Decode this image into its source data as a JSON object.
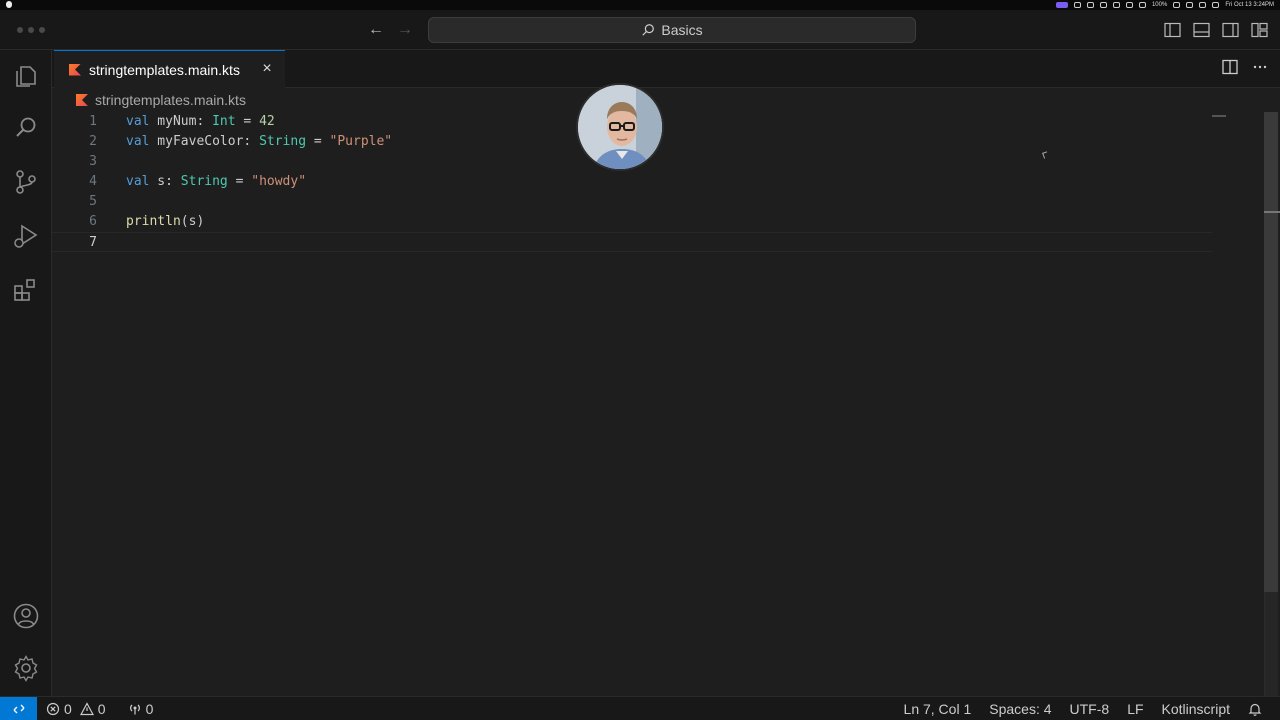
{
  "titlebar": {
    "search_label": "Basics"
  },
  "tab": {
    "label": "stringtemplates.main.kts",
    "close_glyph": "×"
  },
  "breadcrumb": {
    "file": "stringtemplates.main.kts"
  },
  "editor": {
    "line_numbers": [
      "1",
      "2",
      "3",
      "4",
      "5",
      "6",
      "7"
    ],
    "current_line": 7,
    "lines": [
      [
        {
          "t": "val",
          "c": "kw"
        },
        {
          "t": " myNum: ",
          "c": ""
        },
        {
          "t": "Int",
          "c": "ty"
        },
        {
          "t": " = ",
          "c": ""
        },
        {
          "t": "42",
          "c": "num"
        }
      ],
      [
        {
          "t": "val",
          "c": "kw"
        },
        {
          "t": " myFaveColor: ",
          "c": ""
        },
        {
          "t": "String",
          "c": "ty"
        },
        {
          "t": " = ",
          "c": ""
        },
        {
          "t": "\"Purple\"",
          "c": "str"
        }
      ],
      [],
      [
        {
          "t": "val",
          "c": "kw"
        },
        {
          "t": " s: ",
          "c": ""
        },
        {
          "t": "String",
          "c": "ty"
        },
        {
          "t": " = ",
          "c": ""
        },
        {
          "t": "\"howdy\"",
          "c": "str"
        }
      ],
      [],
      [
        {
          "t": "println",
          "c": "fn"
        },
        {
          "t": "(s)",
          "c": ""
        }
      ],
      []
    ]
  },
  "status": {
    "errors": "0",
    "warnings": "0",
    "ports": "0",
    "position": "Ln 7, Col 1",
    "indent": "Spaces: 4",
    "encoding": "UTF-8",
    "eol": "LF",
    "language": "Kotlinscript"
  },
  "menubar": {
    "clock": "Fri Oct 13  3:24PM",
    "battery": "100%"
  },
  "icons": {
    "kotlin_file": "kotlin-file-icon",
    "explorer": "files-icon",
    "search": "search-icon",
    "scm": "source-control-icon",
    "debug": "run-debug-icon",
    "extensions": "extensions-icon",
    "account": "account-icon",
    "settings": "gear-icon"
  },
  "colors": {
    "accent": "#0078d4",
    "keyword": "#569cd6",
    "type": "#4ec9b0",
    "string": "#ce9178",
    "number": "#b5cea8",
    "function": "#dcdcaa"
  }
}
